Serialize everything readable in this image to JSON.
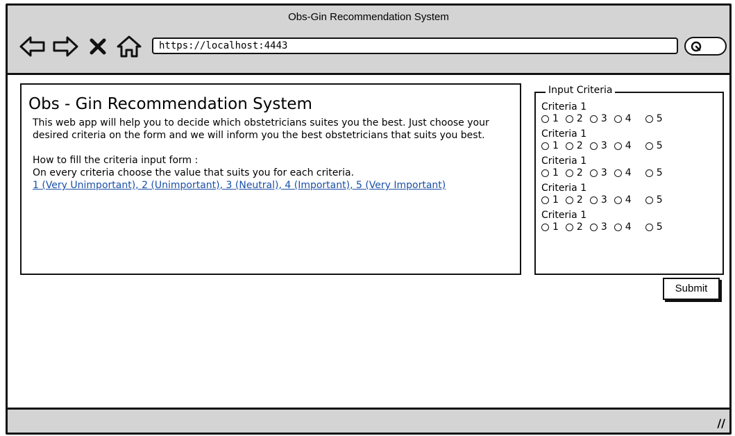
{
  "window": {
    "title": "Obs-Gin Recommendation System",
    "url": "https://localhost:4443",
    "nav_icons": [
      "back-arrow-icon",
      "forward-arrow-icon",
      "close-x-icon",
      "home-icon"
    ],
    "resize_glyph": "//"
  },
  "content": {
    "title": "Obs - Gin Recommendation System",
    "intro": "This web app will help you to decide which obstetricians suites you the best. Just choose your desired criteria on the form and we will inform you the best obstetricians that suits you best.",
    "howto_heading": "How to fill the criteria input form :",
    "howto_text": "On every criteria choose the value that suits you for each criteria.",
    "scale_link": "1 (Very Unimportant), 2 (Unimportant), 3 (Neutral), 4 (Important), 5 (Very Important)"
  },
  "form": {
    "legend": "Input Criteria",
    "criteria": [
      {
        "label": "Criteria 1",
        "options": [
          "1",
          "2",
          "3",
          "4",
          "5"
        ]
      },
      {
        "label": "Criteria 1",
        "options": [
          "1",
          "2",
          "3",
          "4",
          "5"
        ]
      },
      {
        "label": "Criteria 1",
        "options": [
          "1",
          "2",
          "3",
          "4",
          "5"
        ]
      },
      {
        "label": "Criteria 1",
        "options": [
          "1",
          "2",
          "3",
          "4",
          "5"
        ]
      },
      {
        "label": "Criteria 1",
        "options": [
          "1",
          "2",
          "3",
          "4",
          "5"
        ]
      }
    ],
    "submit_label": "Submit"
  }
}
